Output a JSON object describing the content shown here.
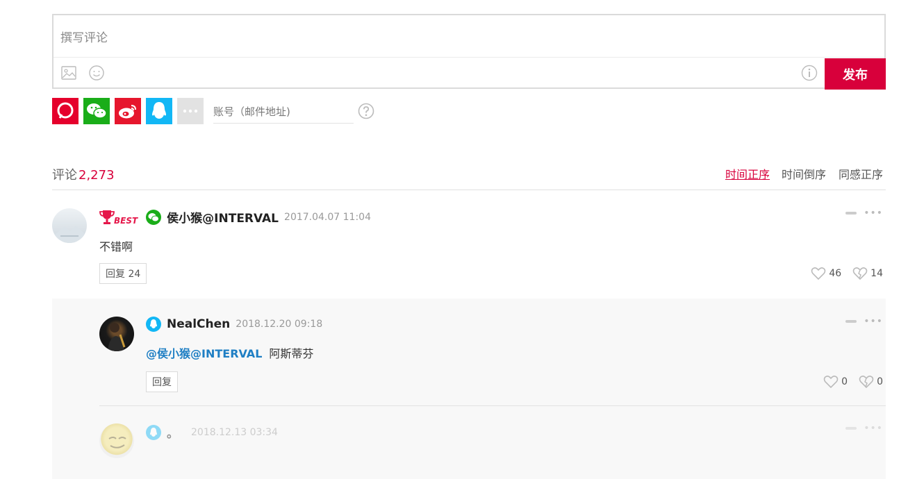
{
  "compose": {
    "placeholder": "撰写评论",
    "publish_label": "发布"
  },
  "share": {
    "account_placeholder": "账号（邮件地址)"
  },
  "comments_header": {
    "title": "评论",
    "count": "2,273",
    "sort_options": [
      "时间正序",
      "时间倒序",
      "同感正序"
    ]
  },
  "comments": [
    {
      "badge": "BEST",
      "user": "侯小猴@INTERVAL",
      "time": "2017.04.07 11:04",
      "text": "不错啊",
      "reply_label": "回复 24",
      "likes": "46",
      "dislikes": "14"
    },
    {
      "user": "NealChen",
      "time": "2018.12.20 09:18",
      "mention": "@侯小猴@INTERVAL",
      "text": "阿斯蒂芬",
      "reply_label": "回复",
      "likes": "0",
      "dislikes": "0"
    },
    {
      "user": "。",
      "time": "2018.12.13 03:34"
    }
  ],
  "colors": {
    "accent": "#d8003b",
    "mention": "#1f7fc4",
    "wechat": "#1aad19",
    "weibo": "#e6162d",
    "qq": "#12b7f5"
  }
}
